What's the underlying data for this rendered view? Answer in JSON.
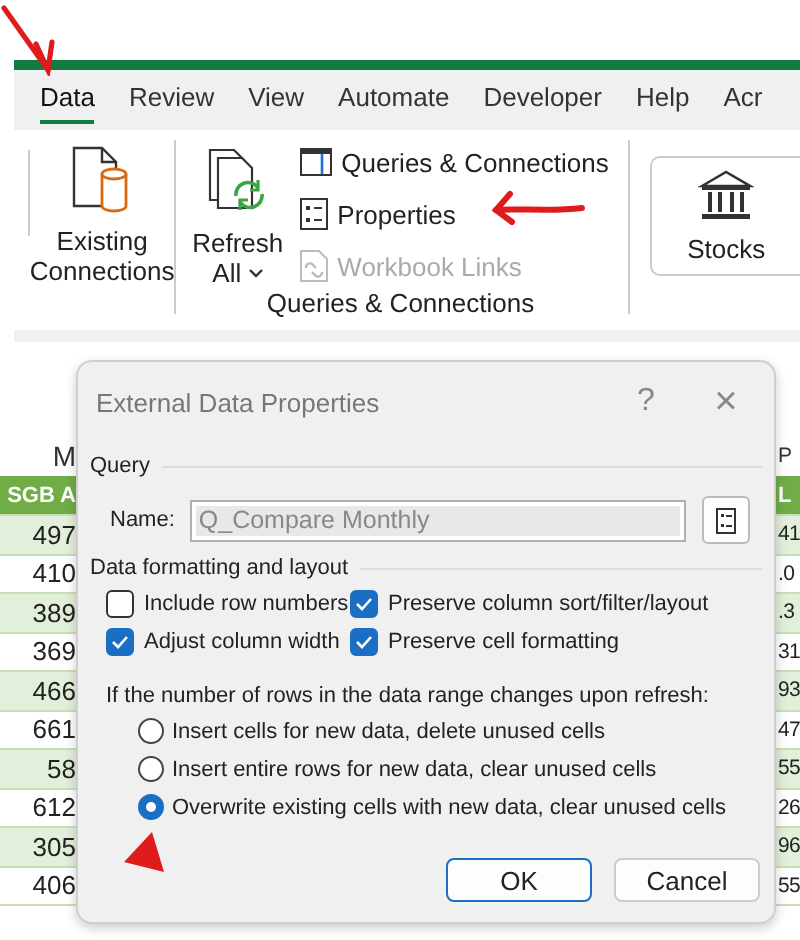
{
  "tabs": [
    {
      "label": "Data",
      "selected": true
    },
    {
      "label": "Review",
      "selected": false
    },
    {
      "label": "View",
      "selected": false
    },
    {
      "label": "Automate",
      "selected": false
    },
    {
      "label": "Developer",
      "selected": false
    },
    {
      "label": "Help",
      "selected": false
    },
    {
      "label": "Acr",
      "selected": false
    }
  ],
  "ribbon": {
    "existing_connections": [
      "Existing",
      "Connections"
    ],
    "refresh_all": [
      "Refresh",
      "All"
    ],
    "queries_items": [
      {
        "label": "Queries & Connections",
        "disabled": false
      },
      {
        "label": "Properties",
        "disabled": false
      },
      {
        "label": "Workbook Links",
        "disabled": true
      }
    ],
    "queries_group_label": "Queries & Connections",
    "stocks": "Stocks"
  },
  "sheet": {
    "column_headers": [
      "M",
      "P"
    ],
    "table_headers": [
      "SGB A",
      "L"
    ],
    "rows": [
      [
        "497",
        "41"
      ],
      [
        "410",
        ".0"
      ],
      [
        "389",
        ".3"
      ],
      [
        "369",
        "31"
      ],
      [
        "466",
        "93"
      ],
      [
        "661",
        "47"
      ],
      [
        "58",
        "55"
      ],
      [
        "612",
        "26"
      ],
      [
        "305",
        "96"
      ],
      [
        "406",
        "55"
      ]
    ]
  },
  "dialog": {
    "title": "External Data Properties",
    "help": "?",
    "close": "×",
    "query_section": "Query",
    "name_label": "Name:",
    "name_value": "Q_Compare Monthly",
    "name_disabled": true,
    "formatting_section": "Data formatting and layout",
    "options": [
      {
        "label": "Include row numbers",
        "checked": false
      },
      {
        "label": "Preserve column sort/filter/layout",
        "checked": true
      },
      {
        "label": "Adjust column width",
        "checked": true
      },
      {
        "label": "Preserve cell formatting",
        "checked": true
      }
    ],
    "rows_prompt": "If the number of rows in the data range changes upon refresh:",
    "row_options": [
      {
        "label": "Insert cells for new data, delete unused cells",
        "selected": false
      },
      {
        "label": "Insert entire rows for new data, clear unused cells",
        "selected": false
      },
      {
        "label": "Overwrite existing cells with new data, clear unused cells",
        "selected": true
      }
    ],
    "buttons": [
      {
        "label": "OK",
        "default": true
      },
      {
        "label": "Cancel",
        "default": false
      }
    ]
  }
}
